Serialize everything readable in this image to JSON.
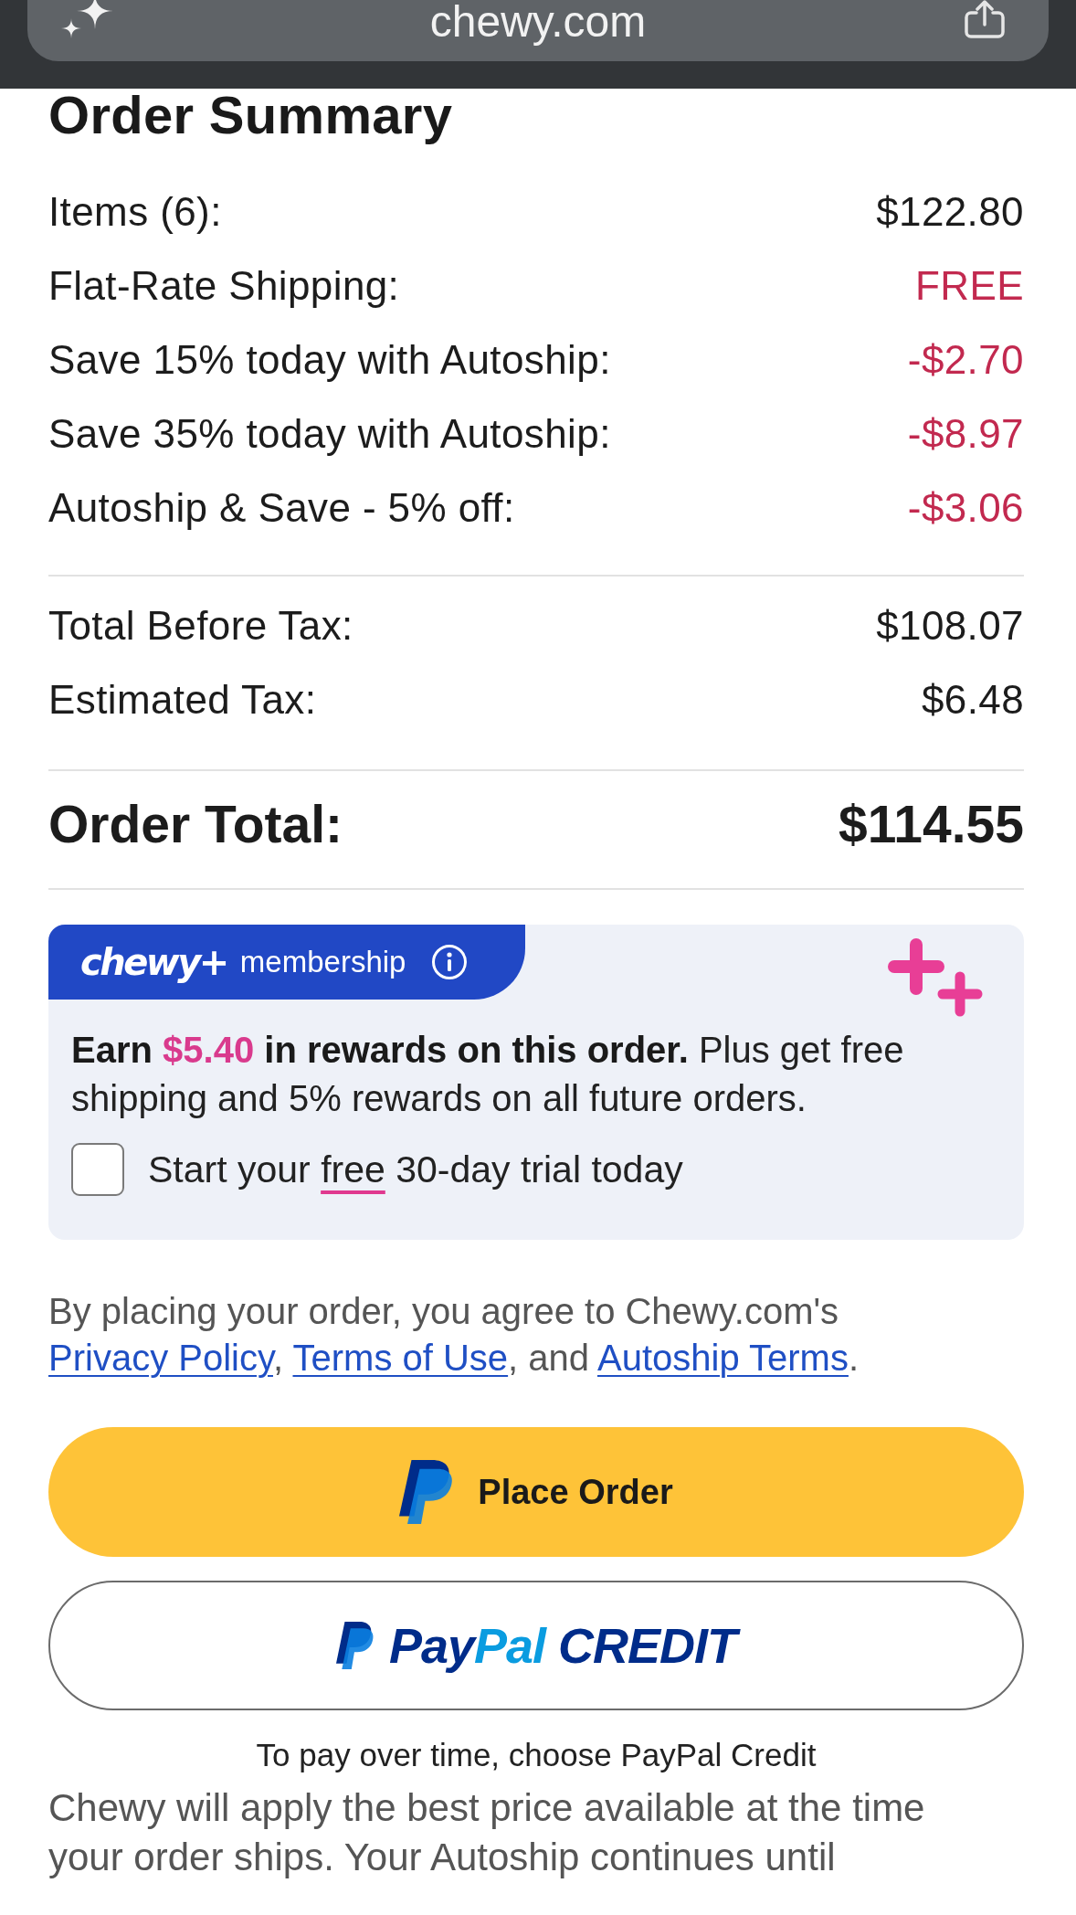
{
  "browser_bar": {
    "url": "chewy.com"
  },
  "order_summary": {
    "title": "Order Summary",
    "line_items": [
      {
        "label": "Items (6):",
        "value": "$122.80",
        "kind": "charge"
      },
      {
        "label": "Flat-Rate Shipping:",
        "value": "FREE",
        "kind": "savings"
      },
      {
        "label": "Save 15% today with Autoship:",
        "value": "-$2.70",
        "kind": "savings"
      },
      {
        "label": "Save 35% today with Autoship:",
        "value": "-$8.97",
        "kind": "savings"
      },
      {
        "label": "Autoship & Save - 5% off:",
        "value": "-$3.06",
        "kind": "savings"
      }
    ],
    "tax_lines": [
      {
        "label": "Total Before Tax:",
        "value": "$108.07"
      },
      {
        "label": "Estimated Tax:",
        "value": "$6.48"
      }
    ],
    "order_total": {
      "label": "Order Total:",
      "value": "$114.55"
    }
  },
  "membership": {
    "logo": "chewy+",
    "tab_label": "membership",
    "message": [
      {
        "text": "Earn ",
        "kind": "bold"
      },
      {
        "text": "$5.40",
        "kind": "highlight"
      },
      {
        "text": " in rewards on this order.",
        "kind": "bold"
      },
      {
        "text": " Plus get free shipping and 5% rewards on all future orders.",
        "kind": "plain"
      }
    ],
    "trial": {
      "checked": false,
      "label": [
        {
          "text": "Start your ",
          "kind": "plain"
        },
        {
          "text": "free",
          "kind": "underlined"
        },
        {
          "text": " 30-day trial today",
          "kind": "plain"
        }
      ]
    }
  },
  "terms": [
    {
      "text": "By placing your order, you agree to Chewy.com's ",
      "kind": "text"
    },
    {
      "text": "Privacy Policy",
      "kind": "link"
    },
    {
      "text": ", ",
      "kind": "text"
    },
    {
      "text": "Terms of Use",
      "kind": "link"
    },
    {
      "text": ", and ",
      "kind": "text"
    },
    {
      "text": "Autoship Terms",
      "kind": "link"
    },
    {
      "text": ".",
      "kind": "text"
    }
  ],
  "place_order_button": {
    "label": "Place Order"
  },
  "paypal_credit_button": {
    "parts": [
      {
        "text": "Pay",
        "kind": "dark"
      },
      {
        "text": "Pal",
        "kind": "light"
      },
      {
        "text": " CREDIT",
        "kind": "dark"
      }
    ]
  },
  "paypal_credit_note": "To pay over time, choose PayPal Credit",
  "price_note": "Chewy will apply the best price available at the time your order ships. Your Autoship continues until"
}
